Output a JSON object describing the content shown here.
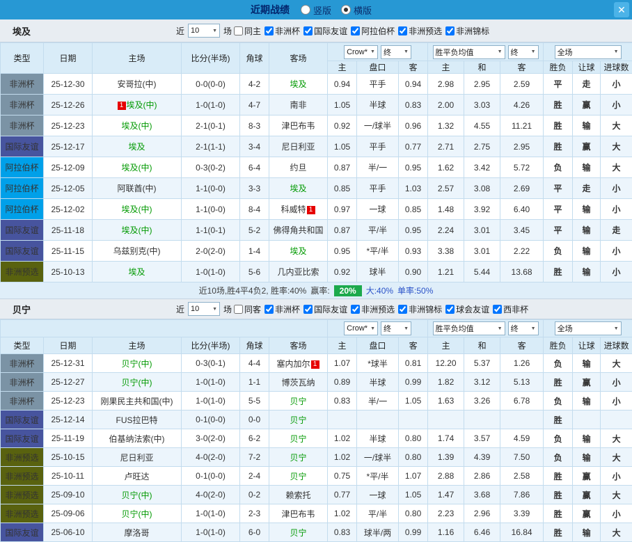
{
  "titlebar": {
    "title": "近期战绩",
    "radios": [
      {
        "label": "竖版",
        "selected": false
      },
      {
        "label": "横版",
        "selected": true
      }
    ],
    "close_glyph": "✕"
  },
  "type_colors": {
    "非洲杯": "#7b93a5",
    "国际友谊": "#47549e",
    "阿拉伯杯": "#00a0e9",
    "非洲预选": "#59620f"
  },
  "result_colors": {
    "win": "#e60000",
    "draw": "#2a52c8",
    "lose": "#009900"
  },
  "sections": [
    {
      "team": "埃及",
      "header_style": "rowspan",
      "filters": {
        "near": "近",
        "count": "10",
        "games": "场",
        "checkboxes": [
          {
            "label": "同主",
            "checked": false
          },
          {
            "label": "非洲杯",
            "checked": true
          },
          {
            "label": "国际友谊",
            "checked": true
          },
          {
            "label": "阿拉伯杯",
            "checked": true
          },
          {
            "label": "非洲预选",
            "checked": true
          },
          {
            "label": "非洲锦标",
            "checked": true
          }
        ]
      },
      "selects": {
        "odds": "Crow*",
        "final1": "终",
        "europe": "胜平负均值",
        "final2": "终",
        "scope": "全场"
      },
      "columns": [
        "类型",
        "日期",
        "主场",
        "比分(半场)",
        "角球",
        "客场"
      ],
      "sub_columns": [
        "主",
        "盘口",
        "客",
        "主",
        "和",
        "客",
        "胜负",
        "让球",
        "进球数"
      ],
      "rows": [
        {
          "type": "非洲杯",
          "date": "25-12-30",
          "home": "安哥拉(中)",
          "home_focal": false,
          "score": "0-0(0-0)",
          "corner": "4-2",
          "away": "埃及",
          "away_focal": true,
          "asia": [
            "0.94",
            "平手",
            "0.94"
          ],
          "euro": [
            "2.98",
            "2.95",
            "2.59"
          ],
          "res": [
            [
              "平",
              "blue"
            ],
            [
              "走",
              "blue"
            ],
            [
              "小",
              "green"
            ]
          ]
        },
        {
          "type": "非洲杯",
          "date": "25-12-26",
          "home": "埃及(中)",
          "home_focal": true,
          "home_badge": {
            "pos": "pre",
            "text": "1"
          },
          "score": "1-0(1-0)",
          "corner": "4-7",
          "away": "南非",
          "away_focal": false,
          "asia": [
            "1.05",
            "半球",
            "0.83"
          ],
          "euro": [
            "2.00",
            "3.03",
            "4.26"
          ],
          "res": [
            [
              "胜",
              "red"
            ],
            [
              "赢",
              "red"
            ],
            [
              "小",
              "green"
            ]
          ]
        },
        {
          "type": "非洲杯",
          "date": "25-12-23",
          "home": "埃及(中)",
          "home_focal": true,
          "score": "2-1(0-1)",
          "corner": "8-3",
          "away": "津巴布韦",
          "away_focal": false,
          "asia": [
            "0.92",
            "一/球半",
            "0.96"
          ],
          "euro": [
            "1.32",
            "4.55",
            "11.21"
          ],
          "res": [
            [
              "胜",
              "red"
            ],
            [
              "输",
              "green"
            ],
            [
              "大",
              "red"
            ]
          ]
        },
        {
          "type": "国际友谊",
          "date": "25-12-17",
          "home": "埃及",
          "home_focal": true,
          "score": "2-1(1-1)",
          "corner": "3-4",
          "away": "尼日利亚",
          "away_focal": false,
          "asia": [
            "1.05",
            "平手",
            "0.77"
          ],
          "euro": [
            "2.71",
            "2.75",
            "2.95"
          ],
          "res": [
            [
              "胜",
              "red"
            ],
            [
              "赢",
              "red"
            ],
            [
              "大",
              "red"
            ]
          ]
        },
        {
          "type": "阿拉伯杯",
          "date": "25-12-09",
          "home": "埃及(中)",
          "home_focal": true,
          "score": "0-3(0-2)",
          "corner": "6-4",
          "away": "约旦",
          "away_focal": false,
          "asia": [
            "0.87",
            "半/一",
            "0.95"
          ],
          "euro": [
            "1.62",
            "3.42",
            "5.72"
          ],
          "res": [
            [
              "负",
              "green"
            ],
            [
              "输",
              "green"
            ],
            [
              "大",
              "red"
            ]
          ]
        },
        {
          "type": "阿拉伯杯",
          "date": "25-12-05",
          "home": "阿联酋(中)",
          "home_focal": false,
          "score": "1-1(0-0)",
          "corner": "3-3",
          "away": "埃及",
          "away_focal": true,
          "asia": [
            "0.85",
            "平手",
            "1.03"
          ],
          "euro": [
            "2.57",
            "3.08",
            "2.69"
          ],
          "res": [
            [
              "平",
              "blue"
            ],
            [
              "走",
              "blue"
            ],
            [
              "小",
              "green"
            ]
          ]
        },
        {
          "type": "阿拉伯杯",
          "date": "25-12-02",
          "home": "埃及(中)",
          "home_focal": true,
          "score": "1-1(0-0)",
          "corner": "8-4",
          "away": "科威特",
          "away_focal": false,
          "away_badge": {
            "pos": "post",
            "text": "1"
          },
          "asia": [
            "0.97",
            "一球",
            "0.85"
          ],
          "euro": [
            "1.48",
            "3.92",
            "6.40"
          ],
          "res": [
            [
              "平",
              "blue"
            ],
            [
              "输",
              "green"
            ],
            [
              "小",
              "green"
            ]
          ]
        },
        {
          "type": "国际友谊",
          "date": "25-11-18",
          "home": "埃及(中)",
          "home_focal": true,
          "score": "1-1(0-1)",
          "corner": "5-2",
          "away": "佛得角共和国",
          "away_focal": false,
          "asia": [
            "0.87",
            "平/半",
            "0.95"
          ],
          "euro": [
            "2.24",
            "3.01",
            "3.45"
          ],
          "res": [
            [
              "平",
              "blue"
            ],
            [
              "输",
              "green"
            ],
            [
              "走",
              "blue"
            ]
          ]
        },
        {
          "type": "国际友谊",
          "date": "25-11-15",
          "home": "乌兹别克(中)",
          "home_focal": false,
          "score": "2-0(2-0)",
          "corner": "1-4",
          "away": "埃及",
          "away_focal": true,
          "asia": [
            "0.95",
            "*平/半",
            "0.93"
          ],
          "euro": [
            "3.38",
            "3.01",
            "2.22"
          ],
          "res": [
            [
              "负",
              "green"
            ],
            [
              "输",
              "green"
            ],
            [
              "小",
              "green"
            ]
          ]
        },
        {
          "type": "非洲预选",
          "date": "25-10-13",
          "home": "埃及",
          "home_focal": true,
          "score": "1-0(1-0)",
          "corner": "5-6",
          "away": "几内亚比索",
          "away_focal": false,
          "asia": [
            "0.92",
            "球半",
            "0.90"
          ],
          "euro": [
            "1.21",
            "5.44",
            "13.68"
          ],
          "res": [
            [
              "胜",
              "red"
            ],
            [
              "输",
              "green"
            ],
            [
              "小",
              "green"
            ]
          ]
        }
      ],
      "summary": [
        {
          "text": "近10场,胜4平4负2, 胜率:40%",
          "color": "#404040"
        },
        {
          "text": "赢率:",
          "color": "#404040"
        },
        {
          "text": "20%",
          "badge": true,
          "color": "#ffffff",
          "bg": "#1ca94c"
        },
        {
          "text": "大:40%",
          "color": "#2a52c8"
        },
        {
          "text": "单率:50%",
          "color": "#2a52c8"
        }
      ]
    },
    {
      "team": "贝宁",
      "header_style": "flat",
      "filters": {
        "near": "近",
        "count": "10",
        "games": "场",
        "checkboxes": [
          {
            "label": "同客",
            "checked": false
          },
          {
            "label": "非洲杯",
            "checked": true
          },
          {
            "label": "国际友谊",
            "checked": true
          },
          {
            "label": "非洲预选",
            "checked": true
          },
          {
            "label": "非洲锦标",
            "checked": true
          },
          {
            "label": "球会友谊",
            "checked": true
          },
          {
            "label": "西非杯",
            "checked": true
          }
        ]
      },
      "selects": {
        "odds": "Crow*",
        "final1": "终",
        "europe": "胜平负均值",
        "final2": "终",
        "scope": "全场"
      },
      "columns": [
        "类型",
        "日期",
        "主场",
        "比分(半场)",
        "角球",
        "客场"
      ],
      "sub_columns": [
        "主",
        "盘口",
        "客",
        "主",
        "和",
        "客",
        "胜负",
        "让球",
        "进球数"
      ],
      "rows": [
        {
          "type": "非洲杯",
          "date": "25-12-31",
          "home": "贝宁(中)",
          "home_focal": true,
          "score": "0-3(0-1)",
          "corner": "4-4",
          "away": "塞内加尔",
          "away_focal": false,
          "away_badge": {
            "pos": "post",
            "text": "1"
          },
          "asia": [
            "1.07",
            "*球半",
            "0.81"
          ],
          "euro": [
            "12.20",
            "5.37",
            "1.26"
          ],
          "res": [
            [
              "负",
              "green"
            ],
            [
              "输",
              "green"
            ],
            [
              "大",
              "red"
            ]
          ]
        },
        {
          "type": "非洲杯",
          "date": "25-12-27",
          "home": "贝宁(中)",
          "home_focal": true,
          "score": "1-0(1-0)",
          "corner": "1-1",
          "away": "博茨瓦纳",
          "away_focal": false,
          "asia": [
            "0.89",
            "半球",
            "0.99"
          ],
          "euro": [
            "1.82",
            "3.12",
            "5.13"
          ],
          "res": [
            [
              "胜",
              "red"
            ],
            [
              "赢",
              "red"
            ],
            [
              "小",
              "green"
            ]
          ]
        },
        {
          "type": "非洲杯",
          "date": "25-12-23",
          "home": "刚果民主共和国(中)",
          "home_focal": false,
          "score": "1-0(1-0)",
          "corner": "5-5",
          "away": "贝宁",
          "away_focal": true,
          "asia": [
            "0.83",
            "半/一",
            "1.05"
          ],
          "euro": [
            "1.63",
            "3.26",
            "6.78"
          ],
          "res": [
            [
              "负",
              "green"
            ],
            [
              "输",
              "green"
            ],
            [
              "小",
              "green"
            ]
          ]
        },
        {
          "type": "国际友谊",
          "date": "25-12-14",
          "home": "FUS拉巴特",
          "home_focal": false,
          "score": "0-1(0-0)",
          "corner": "0-0",
          "away": "贝宁",
          "away_focal": true,
          "asia": [
            "",
            "",
            ""
          ],
          "euro": [
            "",
            "",
            ""
          ],
          "res": [
            [
              "胜",
              "red"
            ],
            null,
            null
          ]
        },
        {
          "type": "国际友谊",
          "date": "25-11-19",
          "home": "伯基纳法索(中)",
          "home_focal": false,
          "score": "3-0(2-0)",
          "corner": "6-2",
          "away": "贝宁",
          "away_focal": true,
          "asia": [
            "1.02",
            "半球",
            "0.80"
          ],
          "euro": [
            "1.74",
            "3.57",
            "4.59"
          ],
          "res": [
            [
              "负",
              "green"
            ],
            [
              "输",
              "green"
            ],
            [
              "大",
              "red"
            ]
          ]
        },
        {
          "type": "非洲预选",
          "date": "25-10-15",
          "home": "尼日利亚",
          "home_focal": false,
          "score": "4-0(2-0)",
          "corner": "7-2",
          "away": "贝宁",
          "away_focal": true,
          "asia": [
            "1.02",
            "一/球半",
            "0.80"
          ],
          "euro": [
            "1.39",
            "4.39",
            "7.50"
          ],
          "res": [
            [
              "负",
              "green"
            ],
            [
              "输",
              "green"
            ],
            [
              "大",
              "red"
            ]
          ]
        },
        {
          "type": "非洲预选",
          "date": "25-10-11",
          "home": "卢旺达",
          "home_focal": false,
          "score": "0-1(0-0)",
          "corner": "2-4",
          "away": "贝宁",
          "away_focal": true,
          "asia": [
            "0.75",
            "*平/半",
            "1.07"
          ],
          "euro": [
            "2.88",
            "2.86",
            "2.58"
          ],
          "res": [
            [
              "胜",
              "red"
            ],
            [
              "赢",
              "red"
            ],
            [
              "小",
              "green"
            ]
          ]
        },
        {
          "type": "非洲预选",
          "date": "25-09-10",
          "home": "贝宁(中)",
          "home_focal": true,
          "score": "4-0(2-0)",
          "corner": "0-2",
          "away": "赖索托",
          "away_focal": false,
          "asia": [
            "0.77",
            "一球",
            "1.05"
          ],
          "euro": [
            "1.47",
            "3.68",
            "7.86"
          ],
          "res": [
            [
              "胜",
              "red"
            ],
            [
              "赢",
              "red"
            ],
            [
              "大",
              "red"
            ]
          ]
        },
        {
          "type": "非洲预选",
          "date": "25-09-06",
          "home": "贝宁(中)",
          "home_focal": true,
          "score": "1-0(1-0)",
          "corner": "2-3",
          "away": "津巴布韦",
          "away_focal": false,
          "asia": [
            "1.02",
            "平/半",
            "0.80"
          ],
          "euro": [
            "2.23",
            "2.96",
            "3.39"
          ],
          "res": [
            [
              "胜",
              "red"
            ],
            [
              "赢",
              "red"
            ],
            [
              "小",
              "green"
            ]
          ]
        },
        {
          "type": "国际友谊",
          "date": "25-06-10",
          "home": "摩洛哥",
          "home_focal": false,
          "score": "1-0(1-0)",
          "corner": "6-0",
          "away": "贝宁",
          "away_focal": true,
          "asia": [
            "0.83",
            "球半/两",
            "0.99"
          ],
          "euro": [
            "1.16",
            "6.46",
            "16.84"
          ],
          "res": [
            [
              "胜",
              "red"
            ],
            [
              "输",
              "green"
            ],
            [
              "大",
              "red"
            ]
          ]
        }
      ]
    }
  ]
}
